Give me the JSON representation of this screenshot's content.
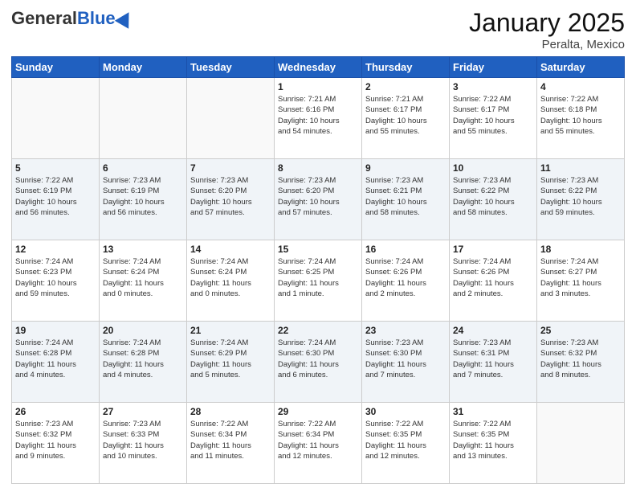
{
  "header": {
    "logo_general": "General",
    "logo_blue": "Blue",
    "month_title": "January 2025",
    "location": "Peralta, Mexico"
  },
  "days_of_week": [
    "Sunday",
    "Monday",
    "Tuesday",
    "Wednesday",
    "Thursday",
    "Friday",
    "Saturday"
  ],
  "weeks": [
    [
      {
        "day": "",
        "text": ""
      },
      {
        "day": "",
        "text": ""
      },
      {
        "day": "",
        "text": ""
      },
      {
        "day": "1",
        "text": "Sunrise: 7:21 AM\nSunset: 6:16 PM\nDaylight: 10 hours\nand 54 minutes."
      },
      {
        "day": "2",
        "text": "Sunrise: 7:21 AM\nSunset: 6:17 PM\nDaylight: 10 hours\nand 55 minutes."
      },
      {
        "day": "3",
        "text": "Sunrise: 7:22 AM\nSunset: 6:17 PM\nDaylight: 10 hours\nand 55 minutes."
      },
      {
        "day": "4",
        "text": "Sunrise: 7:22 AM\nSunset: 6:18 PM\nDaylight: 10 hours\nand 55 minutes."
      }
    ],
    [
      {
        "day": "5",
        "text": "Sunrise: 7:22 AM\nSunset: 6:19 PM\nDaylight: 10 hours\nand 56 minutes."
      },
      {
        "day": "6",
        "text": "Sunrise: 7:23 AM\nSunset: 6:19 PM\nDaylight: 10 hours\nand 56 minutes."
      },
      {
        "day": "7",
        "text": "Sunrise: 7:23 AM\nSunset: 6:20 PM\nDaylight: 10 hours\nand 57 minutes."
      },
      {
        "day": "8",
        "text": "Sunrise: 7:23 AM\nSunset: 6:20 PM\nDaylight: 10 hours\nand 57 minutes."
      },
      {
        "day": "9",
        "text": "Sunrise: 7:23 AM\nSunset: 6:21 PM\nDaylight: 10 hours\nand 58 minutes."
      },
      {
        "day": "10",
        "text": "Sunrise: 7:23 AM\nSunset: 6:22 PM\nDaylight: 10 hours\nand 58 minutes."
      },
      {
        "day": "11",
        "text": "Sunrise: 7:23 AM\nSunset: 6:22 PM\nDaylight: 10 hours\nand 59 minutes."
      }
    ],
    [
      {
        "day": "12",
        "text": "Sunrise: 7:24 AM\nSunset: 6:23 PM\nDaylight: 10 hours\nand 59 minutes."
      },
      {
        "day": "13",
        "text": "Sunrise: 7:24 AM\nSunset: 6:24 PM\nDaylight: 11 hours\nand 0 minutes."
      },
      {
        "day": "14",
        "text": "Sunrise: 7:24 AM\nSunset: 6:24 PM\nDaylight: 11 hours\nand 0 minutes."
      },
      {
        "day": "15",
        "text": "Sunrise: 7:24 AM\nSunset: 6:25 PM\nDaylight: 11 hours\nand 1 minute."
      },
      {
        "day": "16",
        "text": "Sunrise: 7:24 AM\nSunset: 6:26 PM\nDaylight: 11 hours\nand 2 minutes."
      },
      {
        "day": "17",
        "text": "Sunrise: 7:24 AM\nSunset: 6:26 PM\nDaylight: 11 hours\nand 2 minutes."
      },
      {
        "day": "18",
        "text": "Sunrise: 7:24 AM\nSunset: 6:27 PM\nDaylight: 11 hours\nand 3 minutes."
      }
    ],
    [
      {
        "day": "19",
        "text": "Sunrise: 7:24 AM\nSunset: 6:28 PM\nDaylight: 11 hours\nand 4 minutes."
      },
      {
        "day": "20",
        "text": "Sunrise: 7:24 AM\nSunset: 6:28 PM\nDaylight: 11 hours\nand 4 minutes."
      },
      {
        "day": "21",
        "text": "Sunrise: 7:24 AM\nSunset: 6:29 PM\nDaylight: 11 hours\nand 5 minutes."
      },
      {
        "day": "22",
        "text": "Sunrise: 7:24 AM\nSunset: 6:30 PM\nDaylight: 11 hours\nand 6 minutes."
      },
      {
        "day": "23",
        "text": "Sunrise: 7:23 AM\nSunset: 6:30 PM\nDaylight: 11 hours\nand 7 minutes."
      },
      {
        "day": "24",
        "text": "Sunrise: 7:23 AM\nSunset: 6:31 PM\nDaylight: 11 hours\nand 7 minutes."
      },
      {
        "day": "25",
        "text": "Sunrise: 7:23 AM\nSunset: 6:32 PM\nDaylight: 11 hours\nand 8 minutes."
      }
    ],
    [
      {
        "day": "26",
        "text": "Sunrise: 7:23 AM\nSunset: 6:32 PM\nDaylight: 11 hours\nand 9 minutes."
      },
      {
        "day": "27",
        "text": "Sunrise: 7:23 AM\nSunset: 6:33 PM\nDaylight: 11 hours\nand 10 minutes."
      },
      {
        "day": "28",
        "text": "Sunrise: 7:22 AM\nSunset: 6:34 PM\nDaylight: 11 hours\nand 11 minutes."
      },
      {
        "day": "29",
        "text": "Sunrise: 7:22 AM\nSunset: 6:34 PM\nDaylight: 11 hours\nand 12 minutes."
      },
      {
        "day": "30",
        "text": "Sunrise: 7:22 AM\nSunset: 6:35 PM\nDaylight: 11 hours\nand 12 minutes."
      },
      {
        "day": "31",
        "text": "Sunrise: 7:22 AM\nSunset: 6:35 PM\nDaylight: 11 hours\nand 13 minutes."
      },
      {
        "day": "",
        "text": ""
      }
    ]
  ]
}
